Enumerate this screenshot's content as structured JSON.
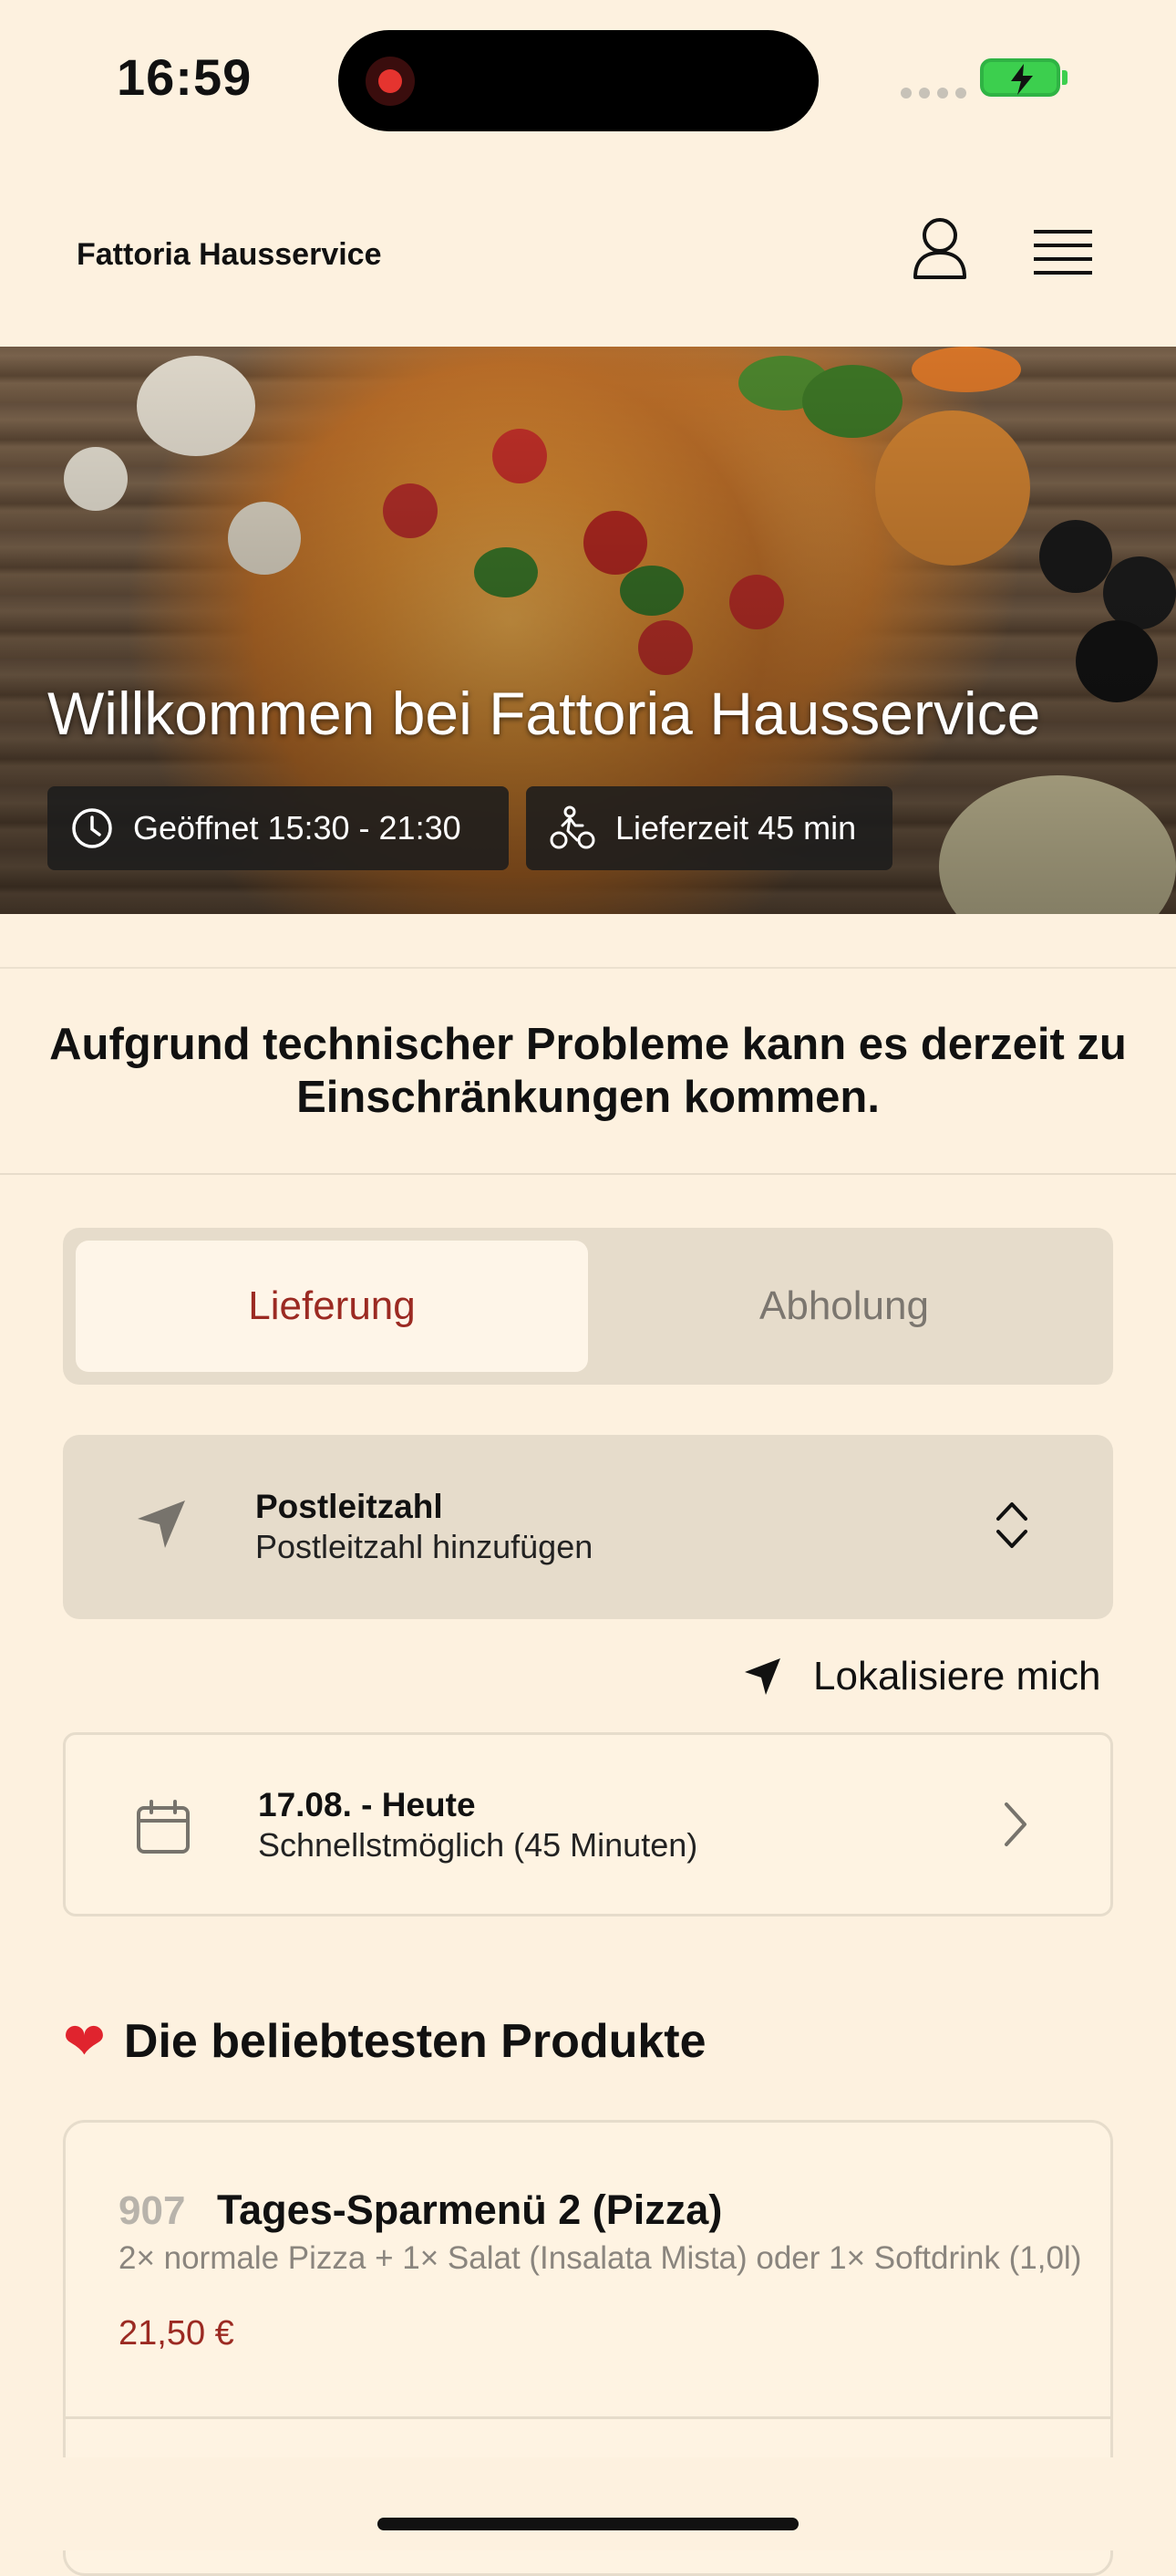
{
  "status_bar": {
    "time": "16:59"
  },
  "header": {
    "brand": "Fattoria Hausservice"
  },
  "hero": {
    "title": "Willkommen bei Fattoria Hausservice",
    "open_hours": "Geöffnet 15:30 - 21:30",
    "delivery_time": "Lieferzeit 45 min"
  },
  "notice": "Aufgrund technischer Probleme kann es derzeit zu Einschränkungen kommen.",
  "order_mode": {
    "options": [
      "Lieferung",
      "Abholung"
    ],
    "selected": "Lieferung"
  },
  "postcode": {
    "label": "Postleitzahl",
    "placeholder": "Postleitzahl hinzufügen"
  },
  "locate": {
    "label": "Lokalisiere mich"
  },
  "date": {
    "title": "17.08. - Heute",
    "subtitle": "Schnellstmöglich (45 Minuten)"
  },
  "popular": {
    "heading": "Die beliebtesten Produkte",
    "items": [
      {
        "number": "907",
        "name": "Tages-Sparmenü 2 (Pizza)",
        "description": "2× normale Pizza + 1× Salat (Insalata Mista) oder 1× Softdrink (1,0l)",
        "price": "21,50 €"
      }
    ]
  },
  "colors": {
    "accent": "#9b2a22",
    "background": "#fdf1df",
    "panel": "#e6dccb"
  }
}
